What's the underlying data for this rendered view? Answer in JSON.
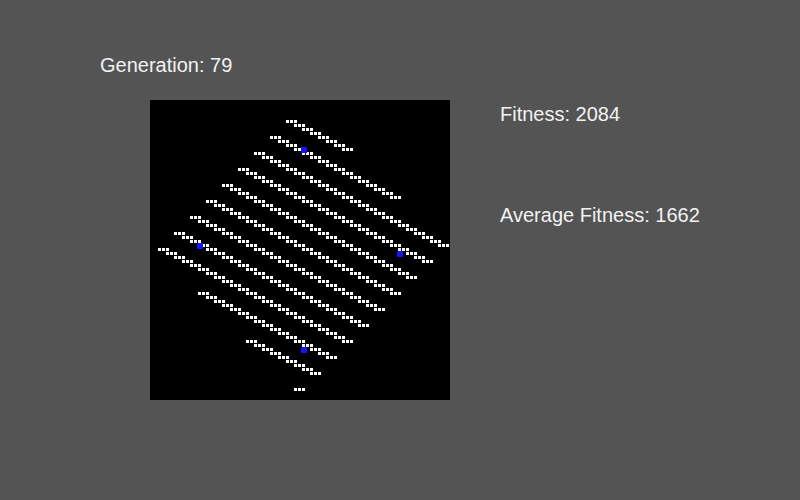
{
  "header": {
    "generation": "Generation: 79"
  },
  "stats": {
    "fitness": "Fitness: 2084",
    "average_fitness": "Average Fitness: 1662"
  },
  "grid": {
    "staircases": [
      {
        "col": 34,
        "row": 5,
        "steps": 8
      },
      {
        "col": 30,
        "row": 9,
        "steps": 16
      },
      {
        "col": 26,
        "row": 13,
        "steps": 24
      },
      {
        "col": 22,
        "row": 17,
        "steps": 24
      },
      {
        "col": 18,
        "row": 21,
        "steps": 24
      },
      {
        "col": 14,
        "row": 25,
        "steps": 24
      },
      {
        "col": 10,
        "row": 29,
        "steps": 24
      },
      {
        "col": 6,
        "row": 33,
        "steps": 24
      },
      {
        "col": 2,
        "row": 37,
        "steps": 24
      },
      {
        "col": 12,
        "row": 48,
        "steps": 17
      },
      {
        "col": 24,
        "row": 60,
        "steps": 9
      },
      {
        "col": 36,
        "row": 72,
        "steps": 1
      }
    ],
    "agents": [
      {
        "col": 38,
        "row": 12
      },
      {
        "col": 12,
        "row": 36
      },
      {
        "col": 62,
        "row": 38
      },
      {
        "col": 38,
        "row": 62
      }
    ]
  }
}
